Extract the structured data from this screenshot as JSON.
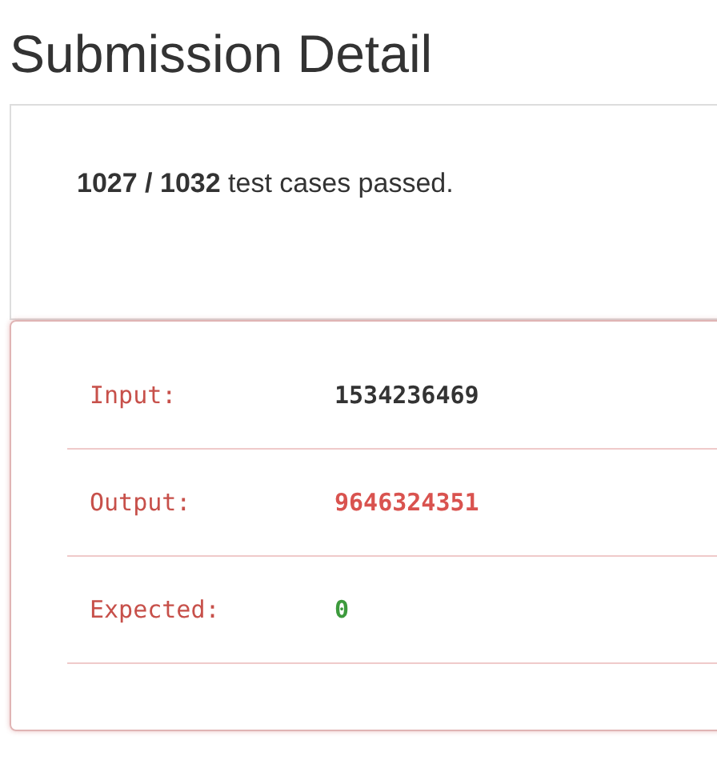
{
  "title": "Submission Detail",
  "summary": "**1027 / 1032** test cases passed.",
  "rows": [
    {
      "label": "Input:",
      "value": "1534236469",
      "color": "#333333"
    },
    {
      "label": "Output:",
      "value": "9646324351",
      "color": "#d9534f"
    },
    {
      "label": "Expected:",
      "value": "0",
      "color": "#3c9a3c"
    }
  ]
}
